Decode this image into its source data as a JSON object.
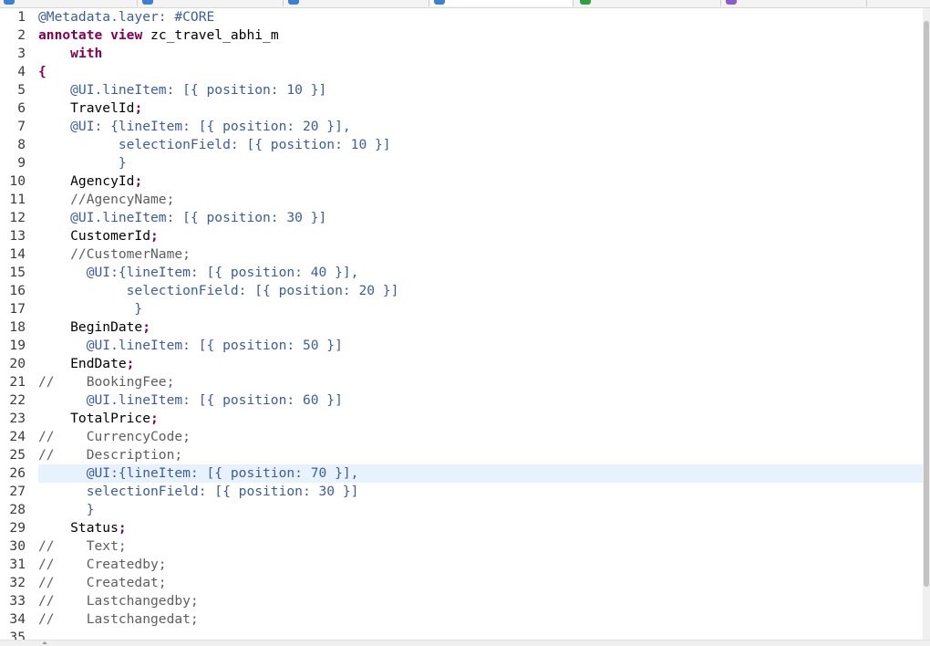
{
  "tabs": [
    {
      "id": "tab-1",
      "icon": "abap-cds-icon",
      "color": "#3f7fd0"
    },
    {
      "id": "tab-2",
      "icon": "abap-cds-icon",
      "color": "#3f7fd0"
    },
    {
      "id": "tab-3",
      "icon": "search-class-icon",
      "color": "#3f7fd0"
    },
    {
      "id": "tab-4",
      "icon": "abap-cds-icon",
      "color": "#3f7fd0",
      "active": true
    },
    {
      "id": "tab-5",
      "icon": "behavior-definition-icon",
      "color": "#2ea043"
    },
    {
      "id": "tab-6",
      "icon": "metadata-extension-icon",
      "color": "#8b5cc8"
    }
  ],
  "colors": {
    "annotation": "#3d5e95",
    "keyword": "#7f0055",
    "comment": "#5e5e5e",
    "current_line": "#e8f2fe"
  },
  "editor": {
    "current_line": 26,
    "lines": [
      {
        "n": "1",
        "tokens": [
          {
            "t": "@Metadata.layer: #CORE",
            "c": "anno"
          }
        ]
      },
      {
        "n": "2",
        "tokens": [
          {
            "t": "annotate",
            "c": "kw"
          },
          {
            "t": " ",
            "c": "ident"
          },
          {
            "t": "view",
            "c": "kw"
          },
          {
            "t": " zc_travel_abhi_m",
            "c": "ident"
          }
        ]
      },
      {
        "n": "3",
        "tokens": [
          {
            "t": "    ",
            "c": "ident"
          },
          {
            "t": "with",
            "c": "kw"
          }
        ]
      },
      {
        "n": "4",
        "tokens": [
          {
            "t": "{",
            "c": "kw"
          }
        ]
      },
      {
        "n": "5",
        "tokens": [
          {
            "t": "    @UI.lineItem: [{ position: 10 }]",
            "c": "anno"
          }
        ]
      },
      {
        "n": "6",
        "tokens": [
          {
            "t": "    TravelId",
            "c": "ident"
          },
          {
            "t": ";",
            "c": "punct"
          }
        ]
      },
      {
        "n": "7",
        "tokens": [
          {
            "t": "    @UI: {lineItem: [{ position: 20 }],",
            "c": "anno"
          }
        ]
      },
      {
        "n": "8",
        "tokens": [
          {
            "t": "          selectionField: [{ position: 10 }]",
            "c": "anno"
          }
        ]
      },
      {
        "n": "9",
        "tokens": [
          {
            "t": "          }",
            "c": "anno"
          }
        ]
      },
      {
        "n": "10",
        "tokens": [
          {
            "t": "    AgencyId",
            "c": "ident"
          },
          {
            "t": ";",
            "c": "punct"
          }
        ]
      },
      {
        "n": "11",
        "tokens": [
          {
            "t": "    //AgencyName;",
            "c": "comment"
          }
        ]
      },
      {
        "n": "12",
        "tokens": [
          {
            "t": "    @UI.lineItem: [{ position: 30 }]",
            "c": "anno"
          }
        ]
      },
      {
        "n": "13",
        "tokens": [
          {
            "t": "    CustomerId",
            "c": "ident"
          },
          {
            "t": ";",
            "c": "punct"
          }
        ]
      },
      {
        "n": "14",
        "tokens": [
          {
            "t": "    //CustomerName;",
            "c": "comment"
          }
        ]
      },
      {
        "n": "15",
        "tokens": [
          {
            "t": "      @UI:{lineItem: [{ position: 40 }],",
            "c": "anno"
          }
        ]
      },
      {
        "n": "16",
        "tokens": [
          {
            "t": "           selectionField: [{ position: 20 }]",
            "c": "anno"
          }
        ]
      },
      {
        "n": "17",
        "tokens": [
          {
            "t": "            }",
            "c": "anno"
          }
        ]
      },
      {
        "n": "18",
        "tokens": [
          {
            "t": "    BeginDate",
            "c": "ident"
          },
          {
            "t": ";",
            "c": "punct"
          }
        ]
      },
      {
        "n": "19",
        "tokens": [
          {
            "t": "      @UI.lineItem: [{ position: 50 }]",
            "c": "anno"
          }
        ]
      },
      {
        "n": "20",
        "tokens": [
          {
            "t": "    EndDate",
            "c": "ident"
          },
          {
            "t": ";",
            "c": "punct"
          }
        ]
      },
      {
        "n": "21",
        "tokens": [
          {
            "t": "//    BookingFee;",
            "c": "comment"
          }
        ]
      },
      {
        "n": "22",
        "tokens": [
          {
            "t": "      @UI.lineItem: [{ position: 60 }]",
            "c": "anno"
          }
        ]
      },
      {
        "n": "23",
        "tokens": [
          {
            "t": "    TotalPrice",
            "c": "ident"
          },
          {
            "t": ";",
            "c": "punct"
          }
        ]
      },
      {
        "n": "24",
        "tokens": [
          {
            "t": "//    CurrencyCode;",
            "c": "comment"
          }
        ]
      },
      {
        "n": "25",
        "tokens": [
          {
            "t": "//    Description;",
            "c": "comment"
          }
        ]
      },
      {
        "n": "26",
        "tokens": [
          {
            "t": "      @UI:{lineItem: [{ position: 70 }],",
            "c": "anno"
          }
        ]
      },
      {
        "n": "27",
        "tokens": [
          {
            "t": "      selectionField: [{ position: 30 }]",
            "c": "anno"
          }
        ]
      },
      {
        "n": "28",
        "tokens": [
          {
            "t": "      }",
            "c": "anno"
          }
        ]
      },
      {
        "n": "29",
        "tokens": [
          {
            "t": "    Status",
            "c": "ident"
          },
          {
            "t": ";",
            "c": "punct"
          }
        ]
      },
      {
        "n": "30",
        "tokens": [
          {
            "t": "//    Text;",
            "c": "comment"
          }
        ]
      },
      {
        "n": "31",
        "tokens": [
          {
            "t": "//    Createdby;",
            "c": "comment"
          }
        ]
      },
      {
        "n": "32",
        "tokens": [
          {
            "t": "//    Createdat;",
            "c": "comment"
          }
        ]
      },
      {
        "n": "33",
        "tokens": [
          {
            "t": "//    Lastchangedby;",
            "c": "comment"
          }
        ]
      },
      {
        "n": "34",
        "tokens": [
          {
            "t": "//    Lastchangedat;",
            "c": "comment"
          }
        ]
      },
      {
        "n": "35",
        "tokens": []
      }
    ]
  }
}
